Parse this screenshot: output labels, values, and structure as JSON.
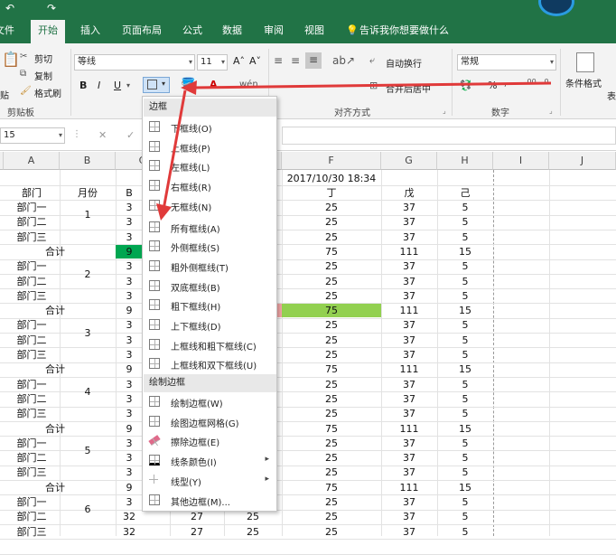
{
  "quick_access": {
    "undo": "↶",
    "redo": "↷"
  },
  "tabs": [
    {
      "label": "文件",
      "active": false
    },
    {
      "label": "开始",
      "active": true
    },
    {
      "label": "插入",
      "active": false
    },
    {
      "label": "页面布局",
      "active": false
    },
    {
      "label": "公式",
      "active": false
    },
    {
      "label": "数据",
      "active": false
    },
    {
      "label": "审阅",
      "active": false
    },
    {
      "label": "视图",
      "active": false
    }
  ],
  "tell_me": "告诉我你想要做什么",
  "ribbon": {
    "cut": "剪切",
    "copy": "复制",
    "format_painter": "格式刷",
    "paste_short": "贴",
    "clipboard_group": "剪贴板",
    "font_name": "等线",
    "font_size": "11",
    "bold": "B",
    "italic": "I",
    "underline": "U",
    "wrap_text": "自动换行",
    "merge_center": "合并后居中",
    "alignment_group": "对齐方式",
    "number_format": "常规",
    "percent": "%",
    "number_group": "数字",
    "conditional_format": "条件格式",
    "table_short": "表"
  },
  "formula_bar": {
    "name_box": "15",
    "cancel": "✕",
    "confirm": "✓"
  },
  "columns": [
    "A",
    "B",
    "C",
    "D",
    "E",
    "F",
    "G",
    "H",
    "I",
    "J"
  ],
  "sheet": {
    "timestamp": "2017/10/30 18:34",
    "header": {
      "a": "部门",
      "b": "月份",
      "c": "B",
      "f": "丁",
      "g": "戊",
      "h": "己"
    },
    "rows": [
      {
        "a": "部门一",
        "c": "3",
        "f": "25",
        "g": "37",
        "h": "5"
      },
      {
        "a": "部门二",
        "b": "1",
        "c": "3",
        "f": "25",
        "g": "37",
        "h": "5"
      },
      {
        "a": "部门三",
        "c": "3",
        "f": "25",
        "g": "37",
        "h": "5"
      },
      {
        "a": "合计",
        "c": "9",
        "f": "75",
        "g": "111",
        "h": "15",
        "total": true
      },
      {
        "a": "部门一",
        "c": "3",
        "f": "25",
        "g": "37",
        "h": "5"
      },
      {
        "a": "部门二",
        "b": "2",
        "c": "3",
        "f": "25",
        "g": "37",
        "h": "5"
      },
      {
        "a": "部门三",
        "c": "3",
        "f": "25",
        "g": "37",
        "h": "5"
      },
      {
        "a": "合计",
        "c": "9",
        "f": "75",
        "g": "111",
        "h": "15",
        "total": true
      },
      {
        "a": "部门一",
        "c": "3",
        "f": "25",
        "g": "37",
        "h": "5"
      },
      {
        "a": "部门二",
        "b": "3",
        "c": "3",
        "f": "25",
        "g": "37",
        "h": "5"
      },
      {
        "a": "部门三",
        "c": "3",
        "f": "25",
        "g": "37",
        "h": "5"
      },
      {
        "a": "合计",
        "c": "9",
        "f": "75",
        "g": "111",
        "h": "15",
        "total": true
      },
      {
        "a": "部门一",
        "c": "3",
        "f": "25",
        "g": "37",
        "h": "5"
      },
      {
        "a": "部门二",
        "b": "4",
        "c": "3",
        "f": "25",
        "g": "37",
        "h": "5"
      },
      {
        "a": "部门三",
        "c": "3",
        "f": "25",
        "g": "37",
        "h": "5"
      },
      {
        "a": "合计",
        "c": "9",
        "f": "75",
        "g": "111",
        "h": "15",
        "total": true
      },
      {
        "a": "部门一",
        "c": "3",
        "f": "25",
        "g": "37",
        "h": "5"
      },
      {
        "a": "部门二",
        "b": "5",
        "c": "3",
        "f": "25",
        "g": "37",
        "h": "5"
      },
      {
        "a": "部门三",
        "c": "3",
        "f": "25",
        "g": "37",
        "h": "5"
      },
      {
        "a": "合计",
        "c": "9",
        "f": "75",
        "g": "111",
        "h": "15",
        "total": true
      },
      {
        "a": "部门一",
        "c": "3",
        "f": "25",
        "g": "37",
        "h": "5"
      },
      {
        "a": "部门二",
        "b": "6",
        "c": "32",
        "d": "27",
        "e": "25",
        "f": "25",
        "g": "37",
        "h": "5"
      },
      {
        "a": "部门三",
        "c": "32",
        "d": "27",
        "e": "25",
        "f": "25",
        "g": "37",
        "h": "5"
      }
    ]
  },
  "border_menu": {
    "header1": "边框",
    "header2": "绘制边框",
    "items1": [
      "下框线(O)",
      "上框线(P)",
      "左框线(L)",
      "右框线(R)",
      "无框线(N)",
      "所有框线(A)",
      "外侧框线(S)",
      "粗外侧框线(T)",
      "双底框线(B)",
      "粗下框线(H)",
      "上下框线(D)",
      "上框线和粗下框线(C)",
      "上框线和双下框线(U)"
    ],
    "items2": [
      "绘制边框(W)",
      "绘图边框网格(G)",
      "擦除边框(E)",
      "线条颜色(I)",
      "线型(Y)",
      "其他边框(M)..."
    ]
  },
  "colors": {
    "excel_green": "#217346",
    "arrow": "#e03a3a",
    "fill_green": "#92d050",
    "fill_green_dark": "#00a651",
    "fill_pink": "#f4a6a6"
  }
}
